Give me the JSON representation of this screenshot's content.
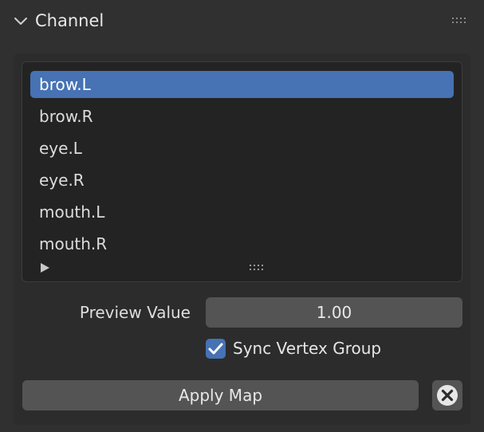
{
  "panel": {
    "title": "Channel"
  },
  "list": {
    "items": [
      {
        "label": "brow.L",
        "selected": true
      },
      {
        "label": "brow.R",
        "selected": false
      },
      {
        "label": "eye.L",
        "selected": false
      },
      {
        "label": "eye.R",
        "selected": false
      },
      {
        "label": "mouth.L",
        "selected": false
      },
      {
        "label": "mouth.R",
        "selected": false
      }
    ]
  },
  "preview": {
    "label": "Preview Value",
    "value": "1.00"
  },
  "sync": {
    "label": "Sync Vertex Group",
    "checked": true
  },
  "actions": {
    "apply_label": "Apply Map",
    "clear_icon": "x-circle-icon"
  },
  "colors": {
    "accent": "#4772b3",
    "background": "#303030",
    "field": "#545454",
    "list_background": "#232323"
  },
  "icons": {
    "collapse": "chevron-down-icon",
    "drag": "drag-handle-icon",
    "expand": "triangle-right-icon",
    "resize": "resize-grip-icon",
    "check": "checkmark-icon"
  }
}
